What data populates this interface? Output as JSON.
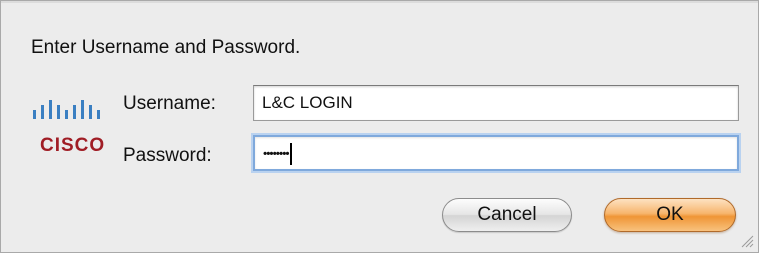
{
  "dialog": {
    "prompt": "Enter Username and Password.",
    "logo": {
      "name": "cisco-logo",
      "word": "CISCO",
      "bar_color": "#3a7fc2",
      "word_color": "#a01d25"
    },
    "username": {
      "label": "Username:",
      "value": "L&C LOGIN"
    },
    "password": {
      "label": "Password:",
      "masked_value": "••••••••",
      "focused": true
    },
    "buttons": {
      "cancel": "Cancel",
      "ok": "OK"
    },
    "colors": {
      "window_bg": "#ececec",
      "focus_ring": "#7fa9dc",
      "default_button": "#f7b56d"
    }
  }
}
